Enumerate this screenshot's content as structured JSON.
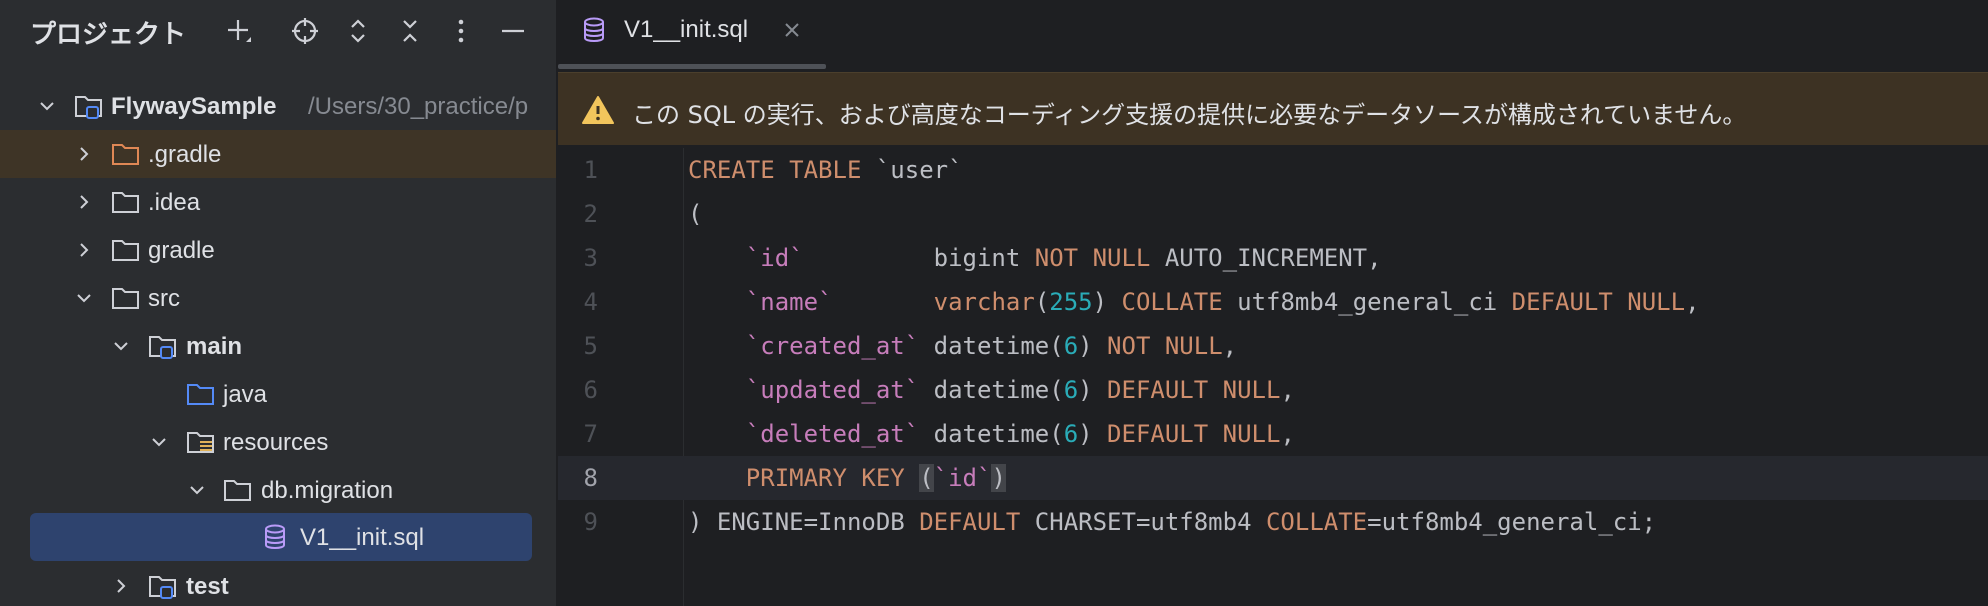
{
  "project_panel": {
    "title": "プロジェクト",
    "tree": [
      {
        "label": "FlywaySample",
        "path": "/Users/30_practice/p",
        "icon": "module-folder-icon",
        "expanded": true,
        "bold": true
      },
      {
        "label": ".gradle",
        "icon": "excluded-folder-icon",
        "expanded": false
      },
      {
        "label": ".idea",
        "icon": "folder-icon",
        "expanded": false
      },
      {
        "label": "gradle",
        "icon": "folder-icon",
        "expanded": false
      },
      {
        "label": "src",
        "icon": "folder-icon",
        "expanded": true
      },
      {
        "label": "main",
        "icon": "module-folder-icon",
        "expanded": true,
        "bold": true
      },
      {
        "label": "java",
        "icon": "source-folder-icon"
      },
      {
        "label": "resources",
        "icon": "resources-folder-icon",
        "expanded": true
      },
      {
        "label": "db.migration",
        "icon": "folder-icon",
        "expanded": true
      },
      {
        "label": "V1__init.sql",
        "icon": "database-file-icon",
        "selected": true
      },
      {
        "label": "test",
        "icon": "module-folder-icon",
        "expanded": false,
        "bold": true
      }
    ]
  },
  "editor": {
    "tab": {
      "label": "V1__init.sql",
      "icon": "database-file-icon"
    },
    "warning": "この SQL の実行、および高度なコーディング支援の提供に必要なデータソースが構成されていません。",
    "current_line": 8,
    "lines": [
      {
        "n": "1",
        "tokens": [
          [
            "kw",
            "CREATE TABLE"
          ],
          [
            "pn",
            " `user`"
          ]
        ]
      },
      {
        "n": "2",
        "tokens": [
          [
            "pn",
            "("
          ]
        ]
      },
      {
        "n": "3",
        "tokens": [
          [
            "pn",
            "    "
          ],
          [
            "col",
            "`id`"
          ],
          [
            "pn",
            "         bigint "
          ],
          [
            "kw",
            "NOT NULL"
          ],
          [
            "pn",
            " AUTO_INCREMENT,"
          ]
        ]
      },
      {
        "n": "4",
        "tokens": [
          [
            "pn",
            "    "
          ],
          [
            "col",
            "`name`"
          ],
          [
            "pn",
            "       "
          ],
          [
            "kw",
            "varchar"
          ],
          [
            "pn",
            "("
          ],
          [
            "num",
            "255"
          ],
          [
            "pn",
            ") "
          ],
          [
            "kw",
            "COLLATE"
          ],
          [
            "pn",
            " utf8mb4_general_ci "
          ],
          [
            "kw",
            "DEFAULT NULL"
          ],
          [
            "pn",
            ","
          ]
        ]
      },
      {
        "n": "5",
        "tokens": [
          [
            "pn",
            "    "
          ],
          [
            "col",
            "`created_at`"
          ],
          [
            "pn",
            " datetime("
          ],
          [
            "num",
            "6"
          ],
          [
            "pn",
            ") "
          ],
          [
            "kw",
            "NOT NULL"
          ],
          [
            "pn",
            ","
          ]
        ]
      },
      {
        "n": "6",
        "tokens": [
          [
            "pn",
            "    "
          ],
          [
            "col",
            "`updated_at`"
          ],
          [
            "pn",
            " datetime("
          ],
          [
            "num",
            "6"
          ],
          [
            "pn",
            ") "
          ],
          [
            "kw",
            "DEFAULT NULL"
          ],
          [
            "pn",
            ","
          ]
        ]
      },
      {
        "n": "7",
        "tokens": [
          [
            "pn",
            "    "
          ],
          [
            "col",
            "`deleted_at`"
          ],
          [
            "pn",
            " datetime("
          ],
          [
            "num",
            "6"
          ],
          [
            "pn",
            ") "
          ],
          [
            "kw",
            "DEFAULT NULL"
          ],
          [
            "pn",
            ","
          ]
        ]
      },
      {
        "n": "8",
        "tokens": [
          [
            "pn",
            "    "
          ],
          [
            "kw",
            "PRIMARY KEY"
          ],
          [
            "pn",
            " "
          ],
          [
            "br",
            "("
          ],
          [
            "col",
            "`id`"
          ],
          [
            "br",
            ")"
          ]
        ]
      },
      {
        "n": "9",
        "tokens": [
          [
            "pn",
            ") ENGINE=InnoDB "
          ],
          [
            "kw",
            "DEFAULT"
          ],
          [
            "pn",
            " CHARSET=utf8mb4 "
          ],
          [
            "kw",
            "COLLATE"
          ],
          [
            "pn",
            "=utf8mb4_general_ci;"
          ]
        ]
      }
    ]
  },
  "colors": {
    "keyword": "#cf8e6d",
    "column": "#c77dbb",
    "number": "#2aacb8",
    "selection": "#2e436e",
    "warning_bg": "#3d3223"
  }
}
